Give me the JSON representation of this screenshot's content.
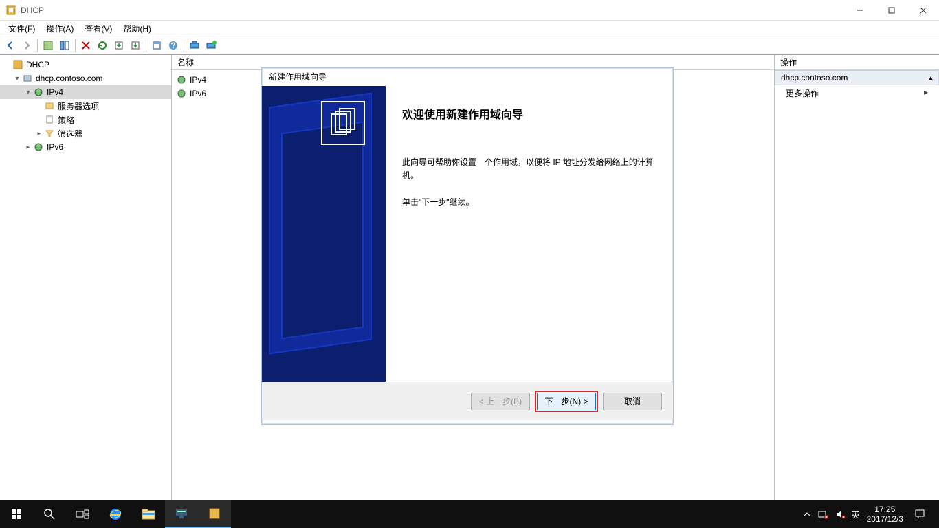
{
  "window": {
    "title": "DHCP"
  },
  "menus": {
    "file": "文件(F)",
    "action": "操作(A)",
    "view": "查看(V)",
    "help": "帮助(H)"
  },
  "tree": {
    "root": "DHCP",
    "server": "dhcp.contoso.com",
    "ipv4": "IPv4",
    "server_options": "服务器选项",
    "policy": "策略",
    "filters": "筛选器",
    "ipv6": "IPv6"
  },
  "list": {
    "column_name": "名称",
    "items": [
      "IPv4",
      "IPv6"
    ]
  },
  "actions_pane": {
    "title": "操作",
    "section": "dhcp.contoso.com",
    "more": "更多操作"
  },
  "wizard": {
    "caption": "新建作用域向导",
    "heading": "欢迎使用新建作用域向导",
    "para1": "此向导可帮助你设置一个作用域，以便将 IP 地址分发给网络上的计算机。",
    "para2": "单击\"下一步\"继续。",
    "back": "< 上一步(B)",
    "next": "下一步(N) >",
    "cancel": "取消"
  },
  "taskbar": {
    "ime": "英",
    "time": "17:25",
    "date": "2017/12/3"
  }
}
